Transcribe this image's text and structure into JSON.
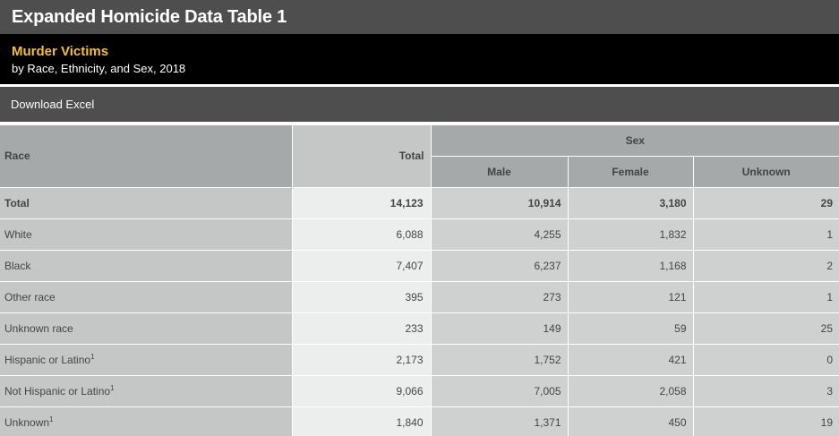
{
  "header": {
    "title": "Expanded Homicide Data Table 1"
  },
  "subtitle": {
    "main": "Murder Victims",
    "sub": "by Race, Ethnicity, and Sex, 2018"
  },
  "toolbar": {
    "download_label": "Download Excel"
  },
  "table": {
    "headers": {
      "race": "Race",
      "total": "Total",
      "sex_group": "Sex",
      "male": "Male",
      "female": "Female",
      "unknown": "Unknown"
    },
    "rows": [
      {
        "race": "Total",
        "sup": "",
        "total": "14,123",
        "male": "10,914",
        "female": "3,180",
        "unknown": "29"
      },
      {
        "race": "White",
        "sup": "",
        "total": "6,088",
        "male": "4,255",
        "female": "1,832",
        "unknown": "1"
      },
      {
        "race": "Black",
        "sup": "",
        "total": "7,407",
        "male": "6,237",
        "female": "1,168",
        "unknown": "2"
      },
      {
        "race": "Other race",
        "sup": "",
        "total": "395",
        "male": "273",
        "female": "121",
        "unknown": "1"
      },
      {
        "race": "Unknown race",
        "sup": "",
        "total": "233",
        "male": "149",
        "female": "59",
        "unknown": "25"
      },
      {
        "race": "Hispanic or Latino",
        "sup": "1",
        "total": "2,173",
        "male": "1,752",
        "female": "421",
        "unknown": "0"
      },
      {
        "race": "Not Hispanic or Latino",
        "sup": "1",
        "total": "9,066",
        "male": "7,005",
        "female": "2,058",
        "unknown": "3"
      },
      {
        "race": "Unknown",
        "sup": "1",
        "total": "1,840",
        "male": "1,371",
        "female": "450",
        "unknown": "19"
      }
    ]
  },
  "colors": {
    "header_bg": "#4e4e4e",
    "subtitle_bg": "#000000",
    "subtitle_accent": "#f5c02a",
    "table_header_bg": "#a6a9a9",
    "race_col_bg": "#c5c7c7",
    "total_col_bg": "#eceeee",
    "num_col_bg": "#cfd1d1"
  }
}
